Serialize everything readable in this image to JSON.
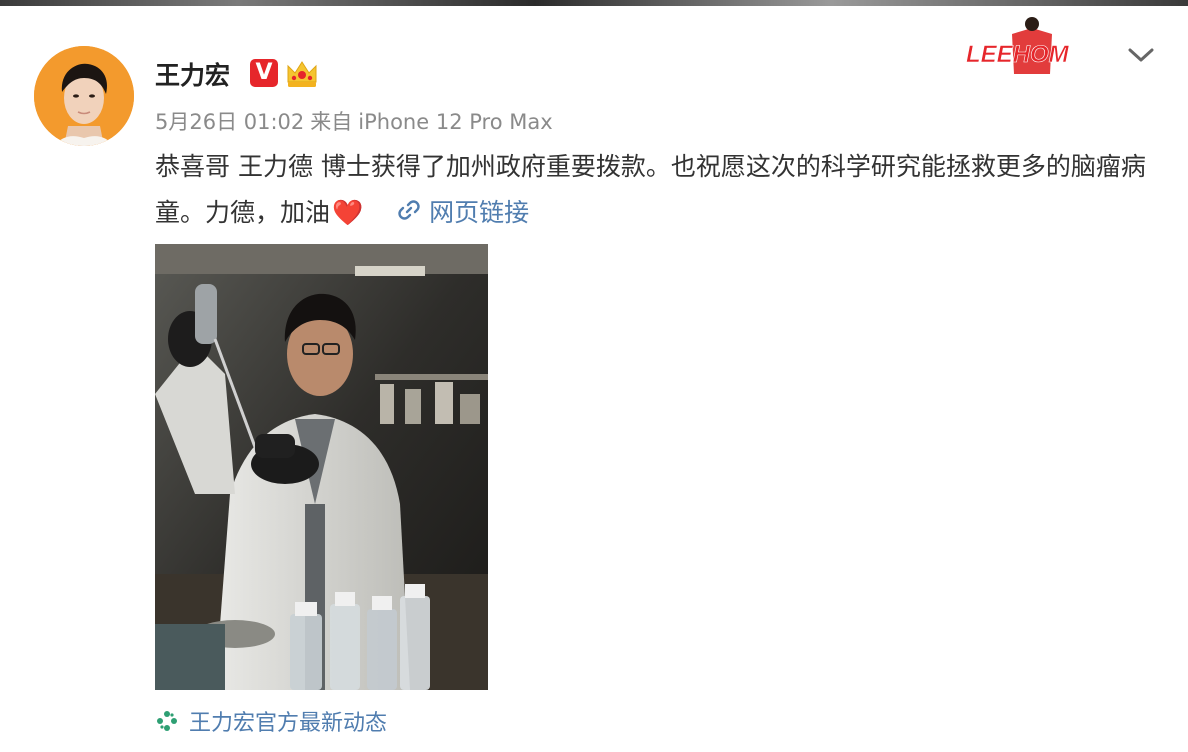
{
  "post": {
    "username": "王力宏",
    "verified_badge": "V",
    "date": "5月26日 01:02",
    "source_prefix": "来自",
    "source": "iPhone 12 Pro Max",
    "text": "恭喜哥 王力德 博士获得了加州政府重要拨款。也祝愿这次的科学研究能拯救更多的脑瘤病童。力德，加油",
    "heart": "❤️",
    "link_label": "网页链接",
    "footer_link": "王力宏官方最新动态",
    "deco_text": "LEEHOM"
  },
  "colors": {
    "link": "#507daf",
    "badge_red": "#e6262b",
    "avatar_bg": "#f39a2d",
    "meta_gray": "#8a8a8a"
  },
  "icons": {
    "link": "link-chain-icon",
    "footer": "pinwheel-icon",
    "more": "chevron-down-icon",
    "crown": "crown-icon"
  }
}
